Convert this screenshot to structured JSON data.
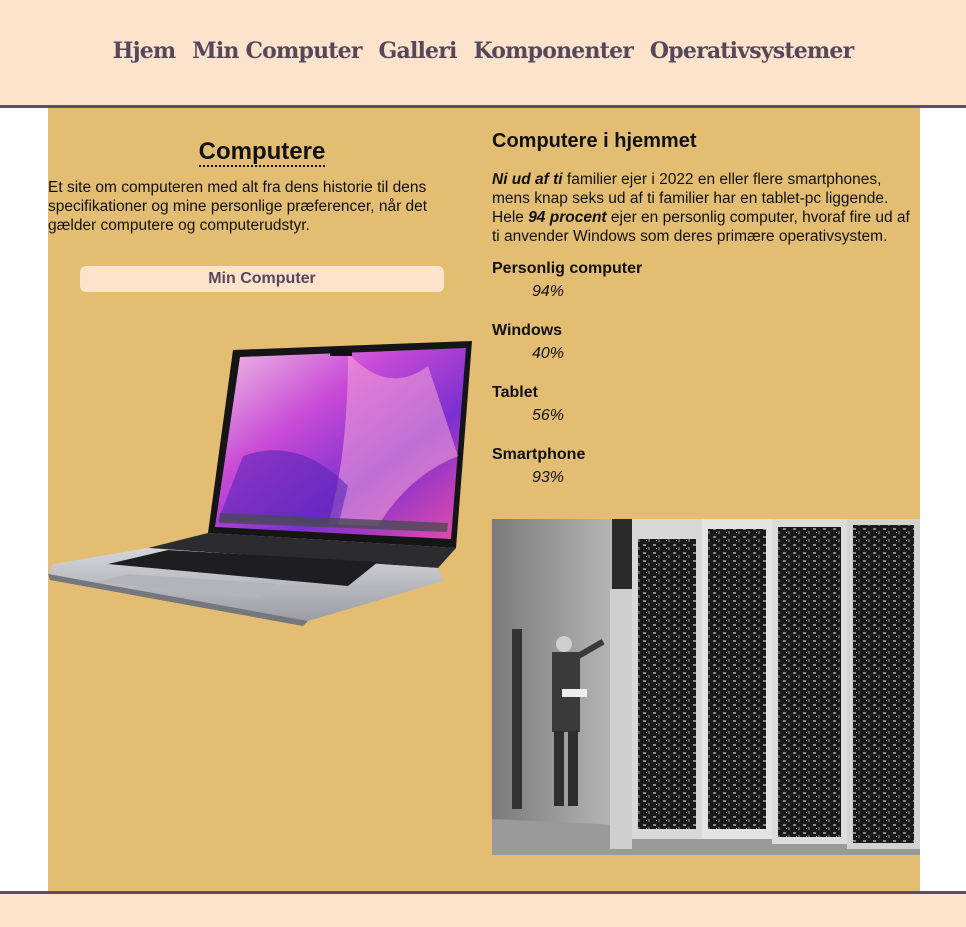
{
  "nav": {
    "items": [
      "Hjem",
      "Min Computer",
      "Galleri",
      "Komponenter",
      "Operativsystemer"
    ]
  },
  "left": {
    "title": "Computere",
    "intro": "Et site om computeren med alt fra dens historie til dens specifikationer og mine personlige præferencer, når det gælder computere og computerudstyr.",
    "button_label": "Min Computer"
  },
  "right": {
    "heading": "Computere i hjemmet",
    "para": {
      "bold1": "Ni ud af ti",
      "text1": " familier ejer i 2022 en eller flere smartphones, mens knap seks ud af ti familier har en tablet-pc liggende. Hele ",
      "bold2": "94 procent",
      "text2": " ejer en personlig computer, hvoraf fire ud af ti anvender Windows som deres primære operativsystem."
    },
    "stats": [
      {
        "label": "Personlig computer",
        "value": "94%"
      },
      {
        "label": "Windows",
        "value": "40%"
      },
      {
        "label": "Tablet",
        "value": "56%"
      },
      {
        "label": "Smartphone",
        "value": "93%"
      }
    ]
  },
  "colors": {
    "header_bg": "#fde2cc",
    "main_bg": "#e3bd72",
    "nav_text": "#55485a",
    "border": "#5a5060"
  }
}
